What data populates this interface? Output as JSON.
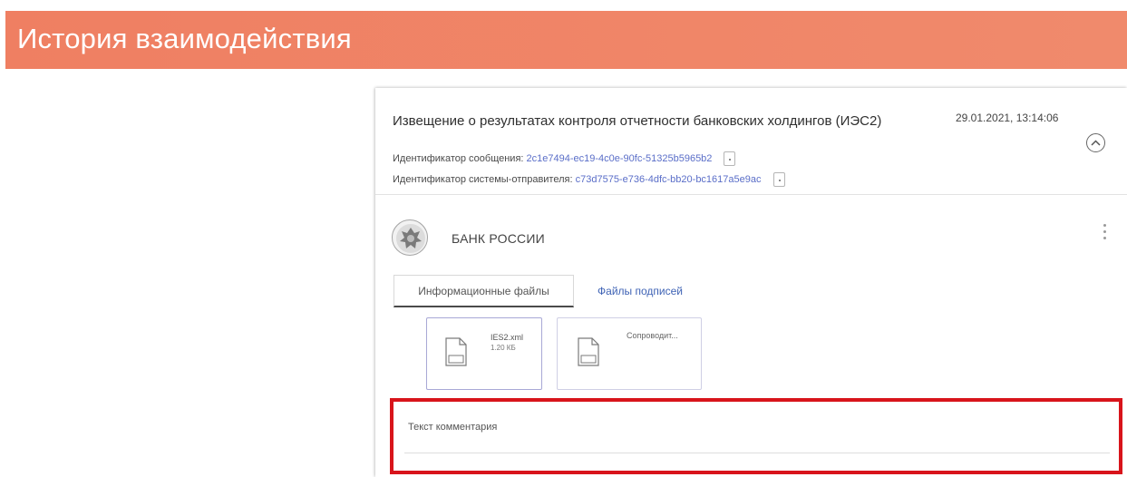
{
  "header": {
    "title": "История взаимодействия"
  },
  "message": {
    "title": "Извещение о результатах контроля отчетности банковских холдингов (ИЭС2)",
    "date": "29.01.2021, 13:14:06",
    "message_id_label": "Идентификатор сообщения:",
    "message_id_value": "2c1e7494-ec19-4c0e-90fc-51325b5965b2",
    "system_id_label": "Идентификатор системы-отправителя:",
    "system_id_value": "c73d7575-e736-4dfc-bb20-bc1617a5e9ac"
  },
  "sender": {
    "name": "БАНК РОССИИ",
    "logo_icon": "bank-of-russia-emblem-icon"
  },
  "tabs": [
    {
      "label": "Информационные файлы",
      "active": true
    },
    {
      "label": "Файлы подписей",
      "active": false
    }
  ],
  "files": [
    {
      "name": "IES2.xml",
      "size": "1.20 КБ",
      "icon": "xml-document-icon"
    },
    {
      "name": "Сопроводит...",
      "size": "",
      "icon": "xml-document-icon"
    }
  ],
  "comment": {
    "placeholder": "Текст комментария"
  },
  "colors": {
    "header": "#ef7f62",
    "link": "#5a6ec8",
    "highlight_border": "#d8141b",
    "tab_link": "#3f63b5"
  }
}
